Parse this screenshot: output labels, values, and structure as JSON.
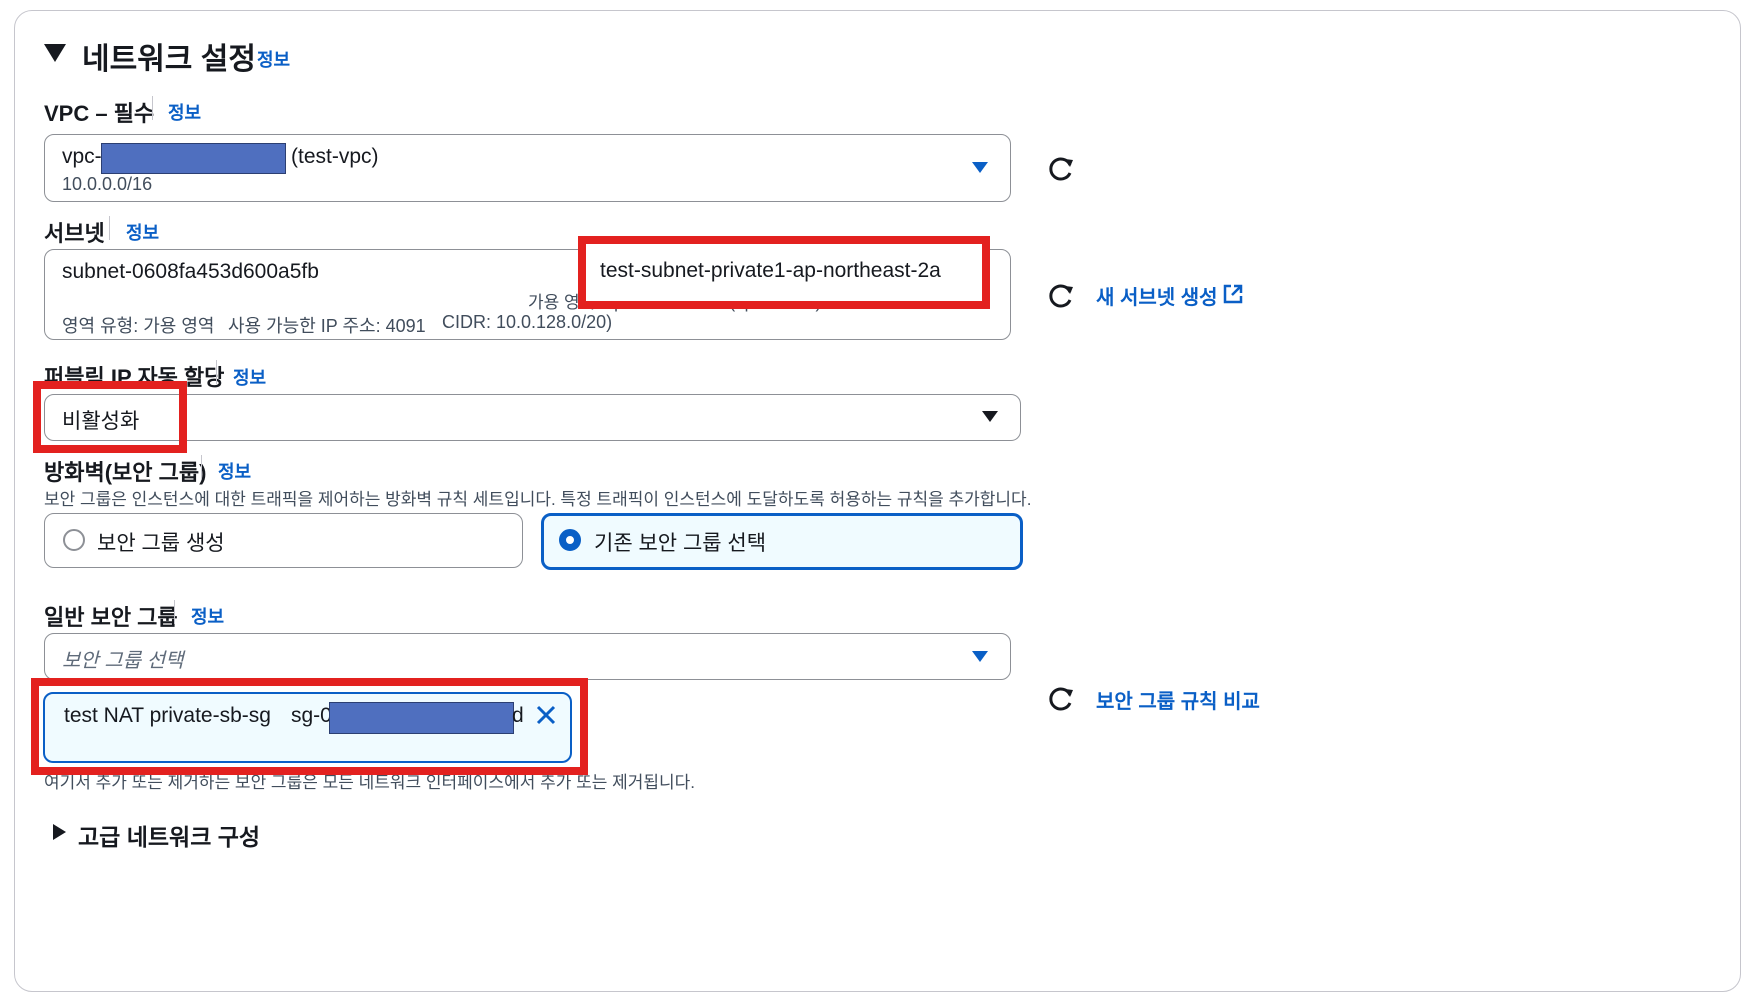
{
  "section": {
    "title": "네트워크 설정",
    "info": "정보"
  },
  "vpc": {
    "label": "VPC – 필수",
    "info": "정보",
    "prefix": "vpc-",
    "name": "(test-vpc)",
    "cidr": "10.0.0.0/16"
  },
  "subnet": {
    "label": "서브넷",
    "info": "정보",
    "id": "subnet-0608fa453d600a5fb",
    "name": "test-subnet-private1-ap-northeast-2a",
    "az_prefix": "가용 영역: ap-northeast-2a (apne2-az1)",
    "zone_type": "영역 유형: 가용 영역",
    "available_ips": "사용 가능한 IP 주소: 4091",
    "cidr": "CIDR: 10.0.128.0/20)",
    "create_link": "새 서브넷 생성"
  },
  "public_ip": {
    "label": "퍼블릭 IP 자동 할당",
    "info": "정보",
    "value": "비활성화"
  },
  "firewall": {
    "label": "방화벽(보안 그룹)",
    "info": "정보",
    "description": "보안 그룹은 인스턴스에 대한 트래픽을 제어하는 방화벽 규칙 세트입니다. 특정 트래픽이 인스턴스에 도달하도록 허용하는 규칙을 추가합니다.",
    "option_create": "보안 그룹 생성",
    "option_existing": "기존 보안 그룹 선택",
    "selected": "option_existing"
  },
  "security_groups": {
    "label": "일반 보안 그룹",
    "info": "정보",
    "placeholder": "보안 그룹 선택",
    "token_name": "test NAT private-sb-sg",
    "token_id_prefix": "sg-0",
    "token_id_suffix": "d",
    "compare_link": "보안 그룹 규칙 비교",
    "note": "여기서 추가 또는 제거하는 보안 그룹은 모든 네트워크 인터페이스에서 추가 또는 제거됩니다."
  },
  "advanced": {
    "label": "고급 네트워크 구성"
  },
  "icons": {
    "collapse": "triangle-down-icon",
    "expand": "triangle-right-icon",
    "refresh": "refresh-icon",
    "external": "external-link-icon",
    "remove": "close-icon",
    "dropdown": "caret-down-icon"
  },
  "colors": {
    "link": "#0a5fc6",
    "highlight": "#e3211f",
    "redaction": "#4f6fbf",
    "selected_bg": "#f0fbff"
  }
}
